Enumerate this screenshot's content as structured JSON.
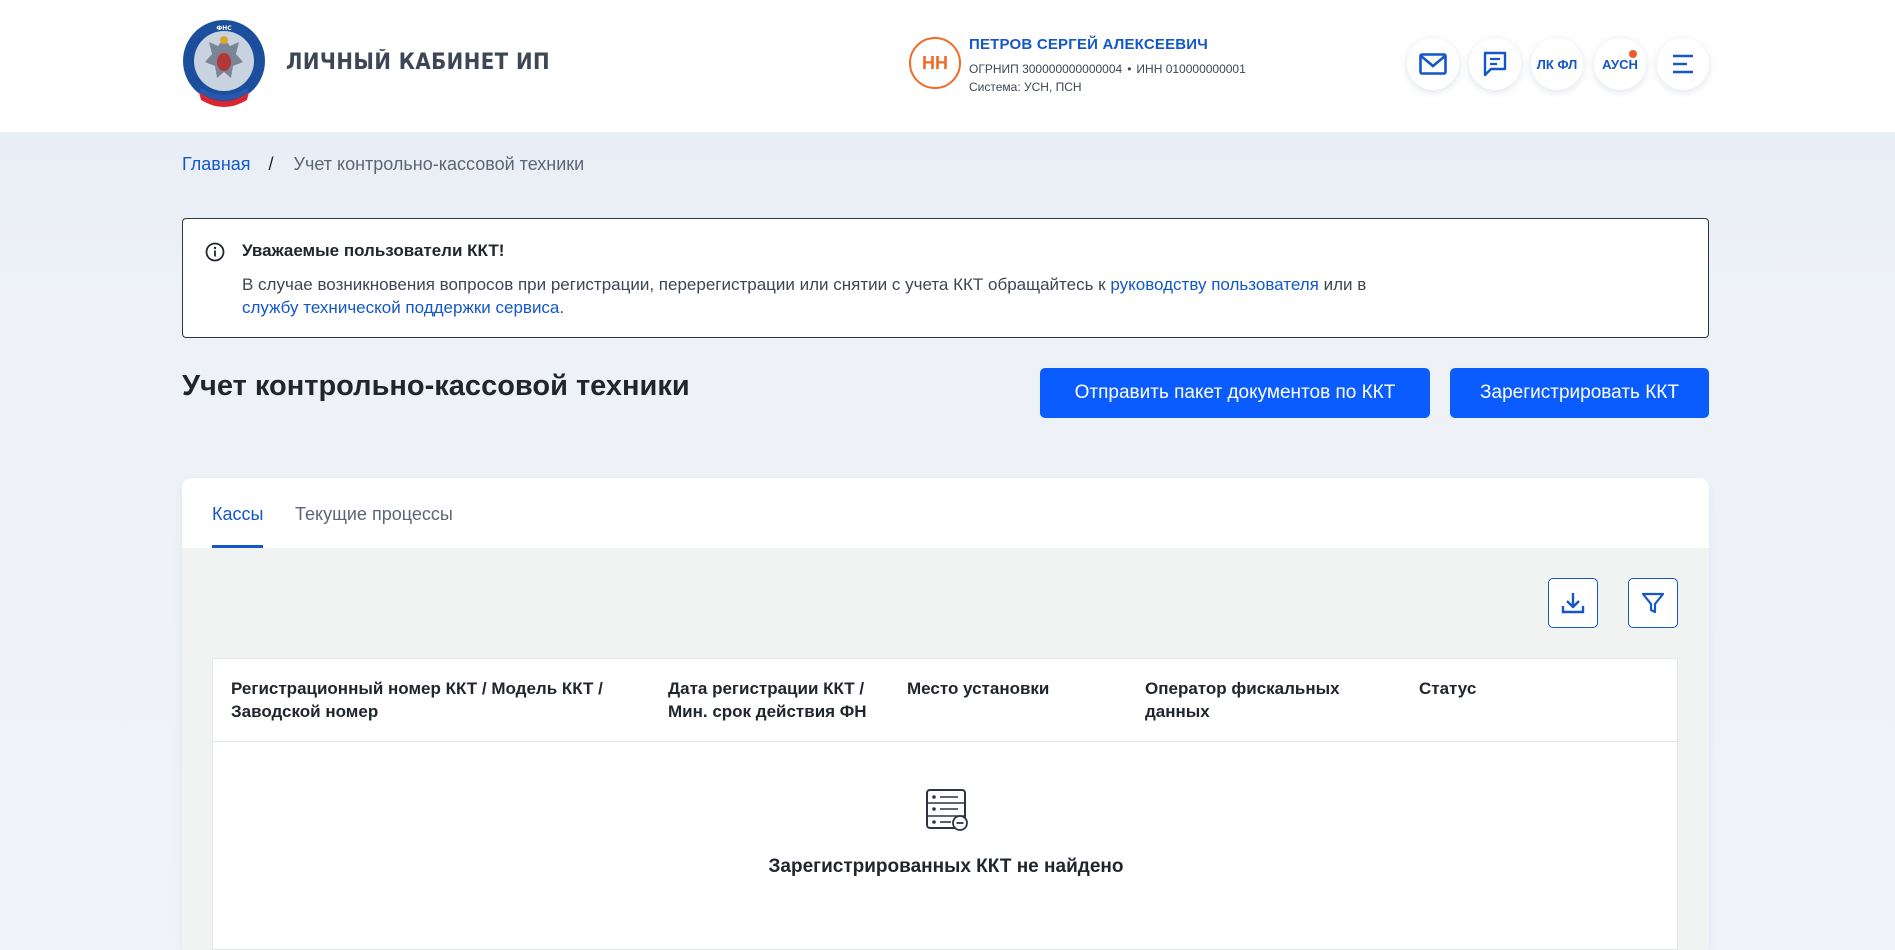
{
  "header": {
    "app_title": "ЛИЧНЫЙ КАБИНЕТ ИП",
    "logo_text": "ФЕДЕРАЛЬНАЯ НАЛОГОВАЯ СЛУЖБА",
    "user": {
      "initials": "НН",
      "name": "ПЕТРОВ СЕРГЕЙ АЛЕКСЕЕВИЧ",
      "ogrnip": "ОГРНИП 300000000000004",
      "inn": "ИНН 010000000001",
      "separator": "•",
      "system": "Система: УСН, ПСН"
    },
    "buttons": {
      "mail_icon": "mail-icon",
      "chat_icon": "chat-icon",
      "lk_fl": "ЛК ФЛ",
      "ausn": "АУСН",
      "menu_icon": "menu-icon"
    }
  },
  "breadcrumb": {
    "home": "Главная",
    "separator": "/",
    "current": "Учет контрольно-кассовой техники"
  },
  "notice": {
    "title": "Уважаемые пользователи ККТ!",
    "text_before": "В случае возникновения вопросов при регистрации, перерегистрации или снятии с учета ККТ обращайтесь к ",
    "link_guide": "руководству пользователя",
    "text_middle": " или в ",
    "link_support": "службу технической поддержки сервиса",
    "text_end": "."
  },
  "page": {
    "title": "Учет контрольно-кассовой техники",
    "send_docs_button": "Отправить пакет документов по ККТ",
    "register_button": "Зарегистрировать ККТ"
  },
  "tabs": [
    {
      "label": "Кассы",
      "active": true
    },
    {
      "label": "Текущие процессы",
      "active": false
    }
  ],
  "table": {
    "columns": [
      "Регистрационный номер ККТ / Модель ККТ / Заводской номер",
      "Дата регистрации ККТ / Мин. срок действия ФН",
      "Место установки",
      "Оператор фискальных данных",
      "Статус"
    ],
    "empty_text": "Зарегистрированных ККТ не найдено"
  },
  "colors": {
    "accent": "#1457c9",
    "primary_button": "#0a5cff",
    "avatar": "#f06a28",
    "notification_dot": "#f05a28"
  }
}
